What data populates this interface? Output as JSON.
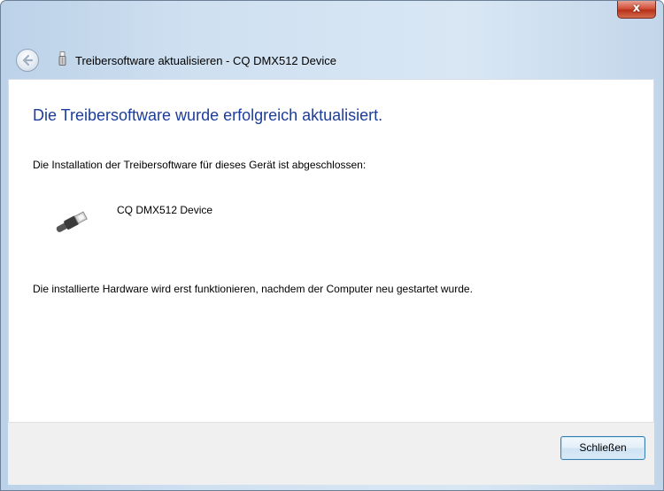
{
  "window": {
    "title": "Treibersoftware aktualisieren - CQ DMX512 Device",
    "close_glyph": "x",
    "icons": {
      "back": "back-arrow-icon",
      "title_icon": "usb-device-icon",
      "close": "close-icon"
    }
  },
  "content": {
    "heading": "Die Treibersoftware wurde erfolgreich aktualisiert.",
    "description": "Die Installation der Treibersoftware für dieses Gerät ist abgeschlossen:",
    "device_name": "CQ DMX512 Device",
    "device_icon": "usb-cable-icon",
    "note": "Die installierte Hardware wird erst funktionieren, nachdem der Computer neu gestartet wurde."
  },
  "footer": {
    "close_button_label": "Schließen"
  },
  "colors": {
    "heading": "#1c3d99",
    "frame": "#cfe0f1",
    "close_red": "#c13d23"
  }
}
